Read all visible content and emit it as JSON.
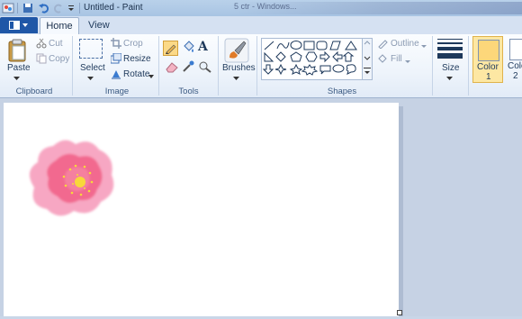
{
  "window": {
    "title": "Untitled - Paint",
    "blurred_title": "5 ctr - Windows..."
  },
  "tabs": {
    "home": "Home",
    "view": "View"
  },
  "clipboard": {
    "paste": "Paste",
    "cut": "Cut",
    "copy": "Copy",
    "group": "Clipboard"
  },
  "image": {
    "select": "Select",
    "crop": "Crop",
    "resize": "Resize",
    "rotate": "Rotate",
    "group": "Image"
  },
  "tools": {
    "group": "Tools",
    "text_glyph": "A"
  },
  "brushes": {
    "label": "Brushes"
  },
  "shapes": {
    "group": "Shapes",
    "outline": "Outline",
    "fill": "Fill"
  },
  "size": {
    "label": "Size"
  },
  "colors": {
    "color1": "Color",
    "color1_num": "1",
    "color2": "Colo",
    "color2_num": "2",
    "color1_value": "#fdd77a"
  },
  "accent": {
    "file_tab": "#1f57a7",
    "flower_outer": "#f6a1c0",
    "flower_inner": "#f2638f",
    "flower_center": "#f8d83a"
  }
}
